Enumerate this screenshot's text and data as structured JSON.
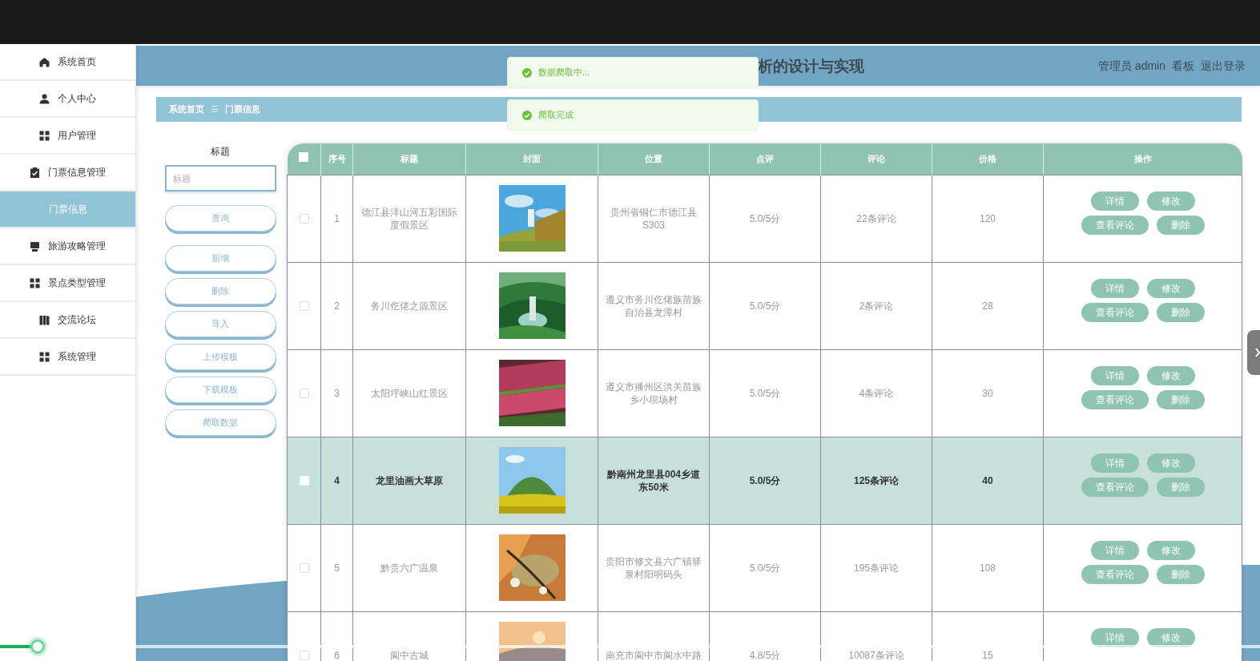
{
  "sidebar": {
    "items": [
      {
        "label": "系统首页",
        "selected": false
      },
      {
        "label": "个人中心",
        "selected": false
      },
      {
        "label": "用户管理",
        "selected": false
      },
      {
        "label": "门票信息管理",
        "selected": false,
        "children": [
          {
            "label": "门票信息",
            "selected": true
          }
        ]
      },
      {
        "label": "旅游攻略管理",
        "selected": false
      },
      {
        "label": "景点类型管理",
        "selected": false
      },
      {
        "label": "交流论坛",
        "selected": false
      },
      {
        "label": "系统管理",
        "selected": false
      }
    ]
  },
  "header": {
    "title": "析的设计与实现",
    "user": "管理员 admin",
    "links": [
      "看板",
      "退出登录"
    ]
  },
  "toasts": [
    {
      "kind": "success",
      "text": "数据爬取中..."
    },
    {
      "kind": "success",
      "text": "爬取完成"
    }
  ],
  "breadcrumb": [
    "系统首页",
    "门票信息"
  ],
  "breadcrumb_separator": "☰",
  "filter": {
    "label": "标题",
    "placeholder": "标题",
    "buttons": [
      "查询",
      "新增",
      "删除",
      "导入",
      "上传模板",
      "下载模板",
      "爬取数据"
    ]
  },
  "table": {
    "all_checked": false,
    "columns": [
      "序号",
      "标题",
      "封面",
      "位置",
      "点评",
      "评论",
      "价格",
      "操作"
    ],
    "rows": [
      {
        "no": "1",
        "title": "德江县洋山河五彩国际度假景区",
        "checked": false,
        "location": "贵州省铜仁市德江县S303",
        "rating": "5.0/5分",
        "comments": "22条评论",
        "price": "120",
        "actions": [
          "详情",
          "修改",
          "查看评论",
          "删除"
        ],
        "selected": false
      },
      {
        "no": "2",
        "title": "务川仡佬之源景区",
        "checked": false,
        "location": "遵义市务川仡佬族苗族自治县龙潭村",
        "rating": "5.0/5分",
        "comments": "2条评论",
        "price": "28",
        "actions": [
          "详情",
          "修改",
          "查看评论",
          "删除"
        ],
        "selected": false
      },
      {
        "no": "3",
        "title": "太阳坪峡山红景区",
        "checked": false,
        "location": "遵义市播州区洪关苗族乡小坝场村",
        "rating": "5.0/5分",
        "comments": "4条评论",
        "price": "30",
        "actions": [
          "详情",
          "修改",
          "查看评论",
          "删除"
        ],
        "selected": false
      },
      {
        "no": "4",
        "title": "龙里油画大草原",
        "checked": false,
        "location": "黔南州龙里县004乡道东50米",
        "rating": "5.0/5分",
        "comments": "125条评论",
        "price": "40",
        "actions": [
          "详情",
          "修改",
          "查看评论",
          "删除"
        ],
        "selected": true
      },
      {
        "no": "5",
        "title": "黔贵六广温泉",
        "checked": false,
        "location": "贵阳市修文县六广镇驿泉村阳明码头",
        "rating": "5.0/5分",
        "comments": "195条评论",
        "price": "108",
        "actions": [
          "详情",
          "修改",
          "查看评论",
          "删除"
        ],
        "selected": false
      },
      {
        "no": "6",
        "title": "阆中古城",
        "checked": false,
        "location": "南充市阆中市阆水中路",
        "rating": "4.8/5分",
        "comments": "10087条评论",
        "price": "15",
        "actions": [
          "详情",
          "修改"
        ],
        "selected": false
      }
    ]
  },
  "video_progress": {
    "level": 0.03
  }
}
